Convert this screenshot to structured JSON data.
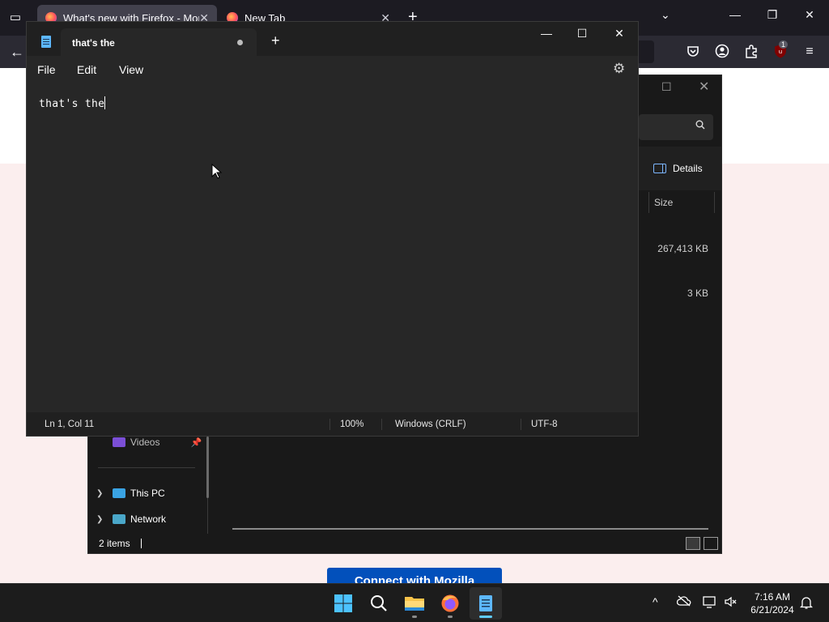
{
  "firefox": {
    "tabs": [
      {
        "title": "What's new with Firefox - More",
        "active": true
      },
      {
        "title": "New Tab",
        "active": false
      }
    ],
    "new_tab_symbol": "+",
    "close_symbol": "✕",
    "toolbar_badge": "1",
    "page_button_label": "Connect with Mozilla"
  },
  "explorer": {
    "details_label": "Details",
    "column_header": "Size",
    "sizes": [
      "267,413 KB",
      "3 KB"
    ],
    "nav_items": [
      {
        "label": "Videos",
        "pinned": true
      },
      {
        "label": "This PC"
      },
      {
        "label": "Network"
      }
    ],
    "status": "2 items"
  },
  "notepad": {
    "tab_title": "that's the",
    "menu": {
      "file": "File",
      "edit": "Edit",
      "view": "View"
    },
    "content": "that's the",
    "status": {
      "position": "Ln 1, Col 11",
      "zoom": "100%",
      "line_ending": "Windows (CRLF)",
      "encoding": "UTF-8"
    }
  },
  "taskbar": {
    "apps": [
      "start-icon",
      "search-icon",
      "file-explorer-icon",
      "firefox-icon",
      "notepad-icon"
    ],
    "time": "7:16 AM",
    "date": "6/21/2024"
  },
  "colors": {
    "accent": "#60cdff",
    "notepad_bg": "#272727",
    "page_pink": "#fbeeee"
  }
}
